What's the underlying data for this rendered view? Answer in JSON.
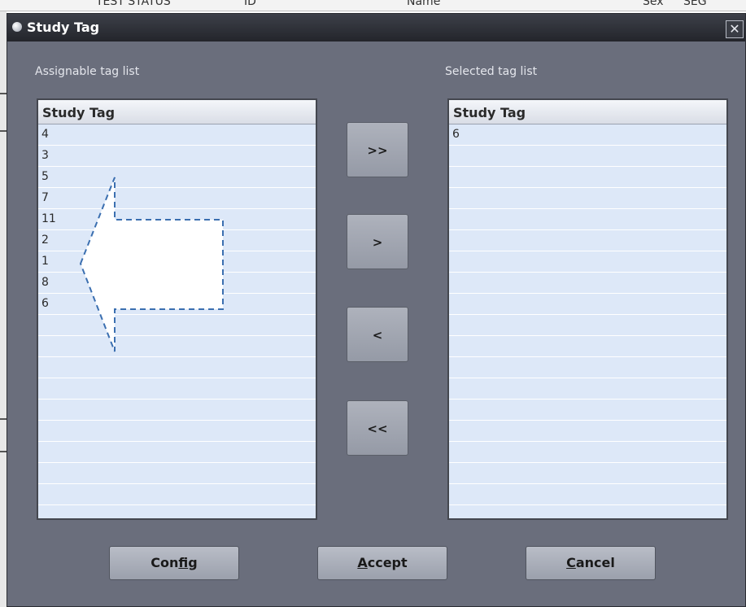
{
  "background": {
    "header_fragments": [
      "TEST STATUS",
      "ID",
      "Name",
      "Sex",
      "SEG"
    ]
  },
  "dialog": {
    "title": "Study Tag",
    "close_glyph": "✕"
  },
  "assignable": {
    "label": "Assignable tag list",
    "column_header": "Study Tag",
    "items": [
      "4",
      "3",
      "5",
      "7",
      "11",
      "2",
      "1",
      "8",
      "6"
    ]
  },
  "selected": {
    "label": "Selected tag list",
    "column_header": "Study Tag",
    "items": [
      "6"
    ]
  },
  "transfer_buttons": {
    "add_all": ">>",
    "add_one": ">",
    "remove_one": "<",
    "remove_all": "<<"
  },
  "footer": {
    "config_prefix": "Con",
    "config_mnemonic": "f",
    "config_suffix": "ig",
    "accept_mnemonic": "A",
    "accept_suffix": "ccept",
    "cancel_mnemonic": "C",
    "cancel_suffix": "ancel"
  },
  "colors": {
    "dialog_bg": "#6a6e7c",
    "list_bg": "#dde8f8",
    "titlebar": "#2b2d33",
    "annotation_stroke": "#3b6fb0"
  },
  "icons": {
    "title_dot": "title-bullet-icon",
    "close": "close-icon",
    "annotation": "left-arrow-callout-icon"
  }
}
